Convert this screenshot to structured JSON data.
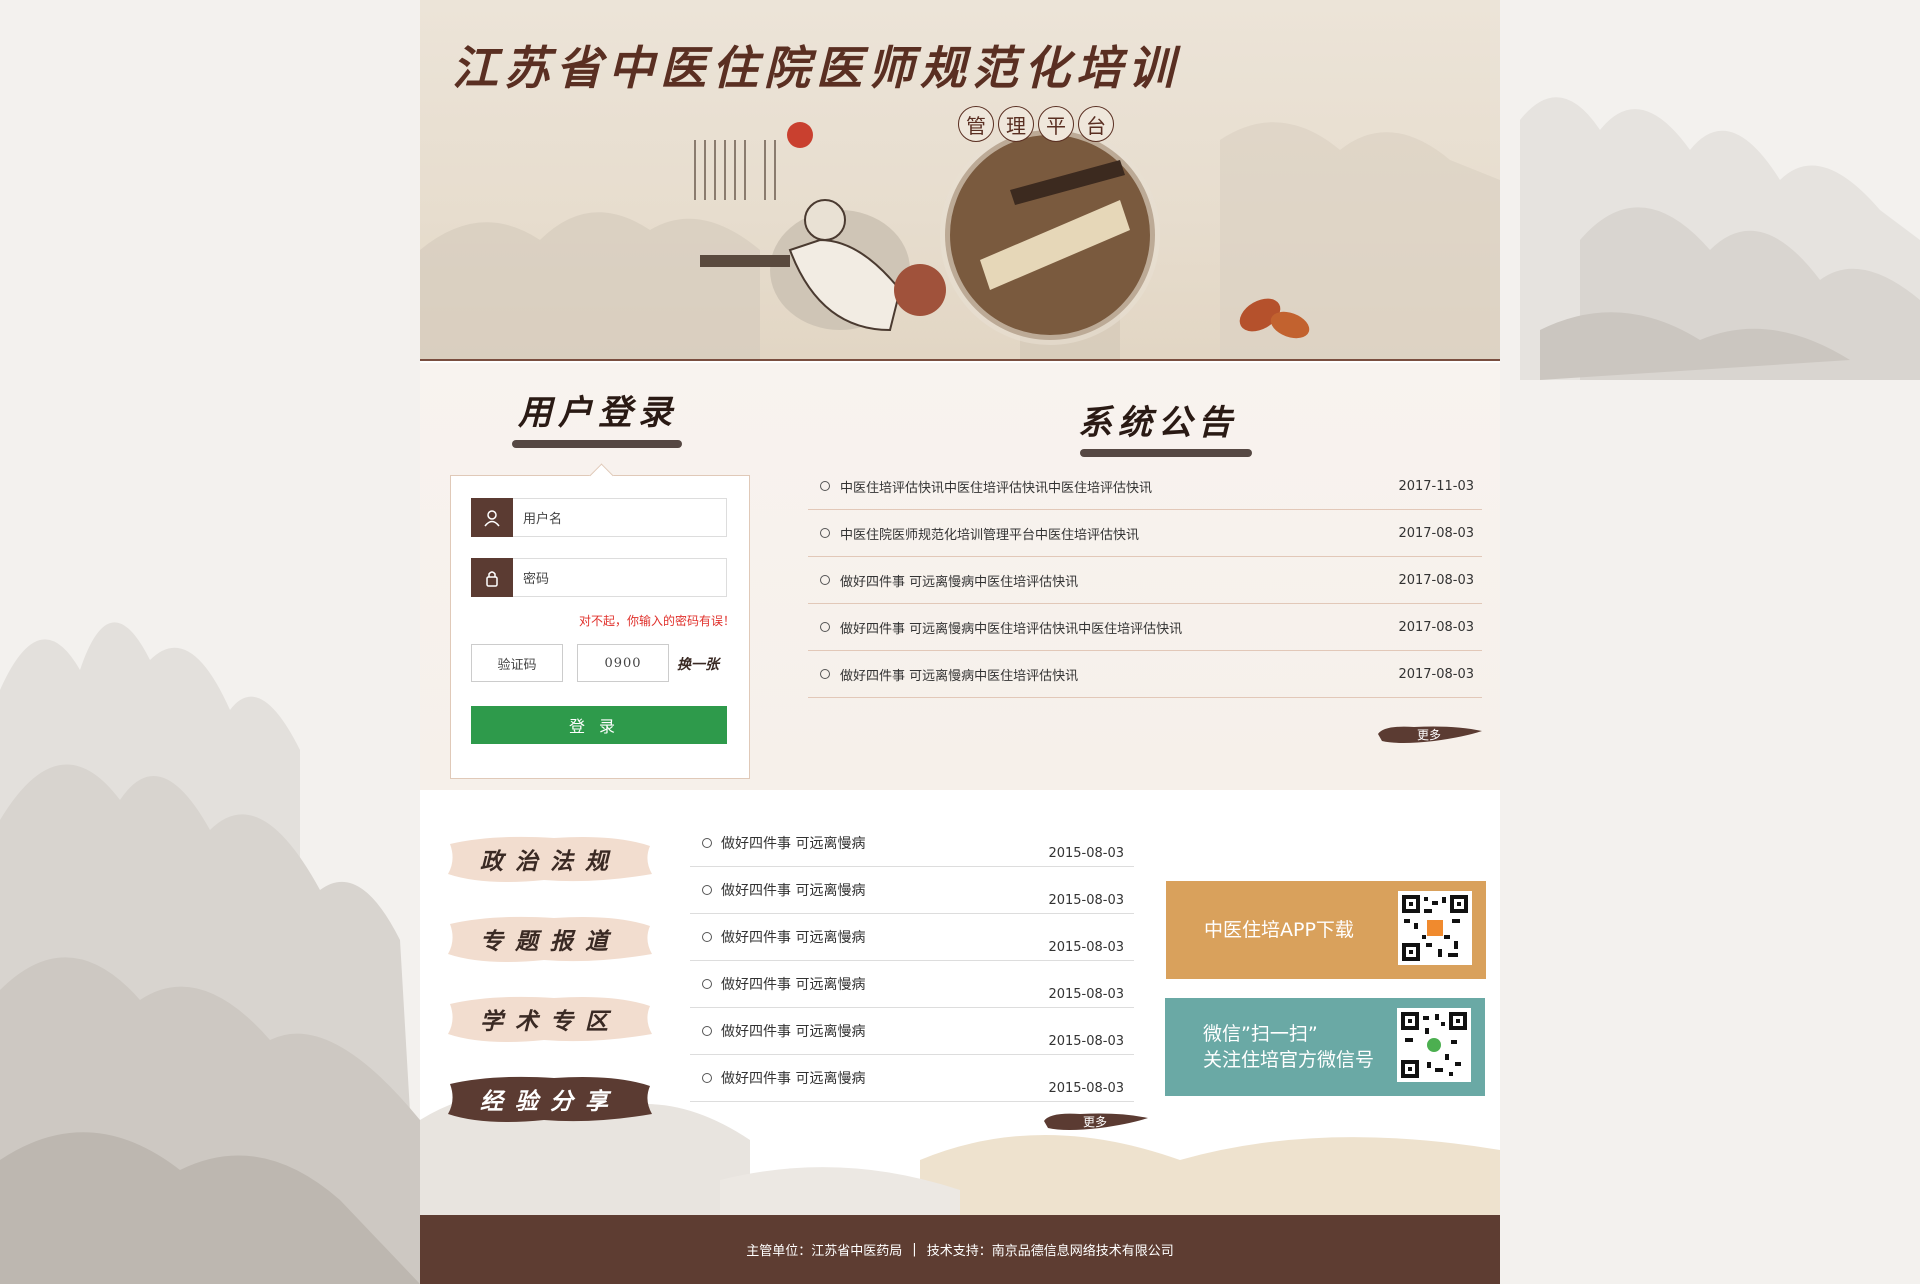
{
  "banner": {
    "title": "江苏省中医住院医师规范化培训",
    "subtitle_chars": [
      "管",
      "理",
      "平",
      "台"
    ]
  },
  "login": {
    "heading": "用户登录",
    "username_placeholder": "用户名",
    "password_placeholder": "密码",
    "error_message": "对不起，你输入的密码有误！",
    "captcha_label": "验证码",
    "captcha_code": "0900",
    "refresh_label": "换一张",
    "submit_label": "登录"
  },
  "notices": {
    "heading": "系统公告",
    "items": [
      {
        "title": "中医住培评估快讯中医住培评估快讯中医住培评估快讯",
        "date": "2017-11-03"
      },
      {
        "title": "中医住院医师规范化培训管理平台中医住培评估快讯",
        "date": "2017-08-03"
      },
      {
        "title": "做好四件事 可远离慢病中医住培评估快讯",
        "date": "2017-08-03"
      },
      {
        "title": "做好四件事 可远离慢病中医住培评估快讯中医住培评估快讯",
        "date": "2017-08-03"
      },
      {
        "title": "做好四件事 可远离慢病中医住培评估快讯",
        "date": "2017-08-03"
      }
    ],
    "more_label": "更多"
  },
  "categories": [
    {
      "label": "政治法规",
      "active": false
    },
    {
      "label": "专题报道",
      "active": false
    },
    {
      "label": "学术专区",
      "active": false
    },
    {
      "label": "经验分享",
      "active": true
    }
  ],
  "news": {
    "items": [
      {
        "title": "做好四件事 可远离慢病",
        "date": "2015-08-03"
      },
      {
        "title": "做好四件事 可远离慢病",
        "date": "2015-08-03"
      },
      {
        "title": "做好四件事 可远离慢病",
        "date": "2015-08-03"
      },
      {
        "title": "做好四件事 可远离慢病",
        "date": "2015-08-03"
      },
      {
        "title": "做好四件事 可远离慢病",
        "date": "2015-08-03"
      },
      {
        "title": "做好四件事 可远离慢病",
        "date": "2015-08-03"
      }
    ],
    "more_label": "更多"
  },
  "promos": {
    "app": {
      "text": "中医住培APP下载",
      "color": "#d9a15c"
    },
    "wechat": {
      "line1": "微信”扫一扫”",
      "line2": "关注住培官方微信号",
      "color": "#6aa9a5"
    }
  },
  "footer": {
    "org": "主管单位：江苏省中医药局",
    "divider": "|",
    "tech": "技术支持：南京品德信息网络技术有限公司"
  },
  "colors": {
    "brand_brown": "#5e3d32",
    "login_green": "#2e9a4b",
    "error_red": "#e0302b"
  }
}
